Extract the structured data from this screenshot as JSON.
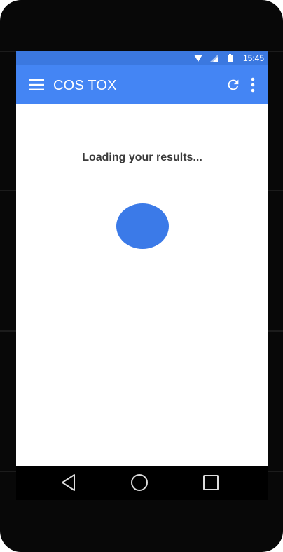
{
  "status_bar": {
    "time": "15:45",
    "icons": [
      "wifi-icon",
      "signal-icon",
      "battery-icon"
    ]
  },
  "app_bar": {
    "title": "COS TOX",
    "icons": [
      "menu-icon",
      "refresh-icon",
      "more-vert-icon"
    ]
  },
  "content": {
    "loading_text": "Loading your results..."
  },
  "nav_bar": {
    "icons": [
      "back-icon",
      "home-icon",
      "recents-icon"
    ]
  },
  "colors": {
    "status_bar": "#3b78e0",
    "app_bar": "#4485f4",
    "spinner": "#3b7ae8",
    "device": "#080808"
  }
}
